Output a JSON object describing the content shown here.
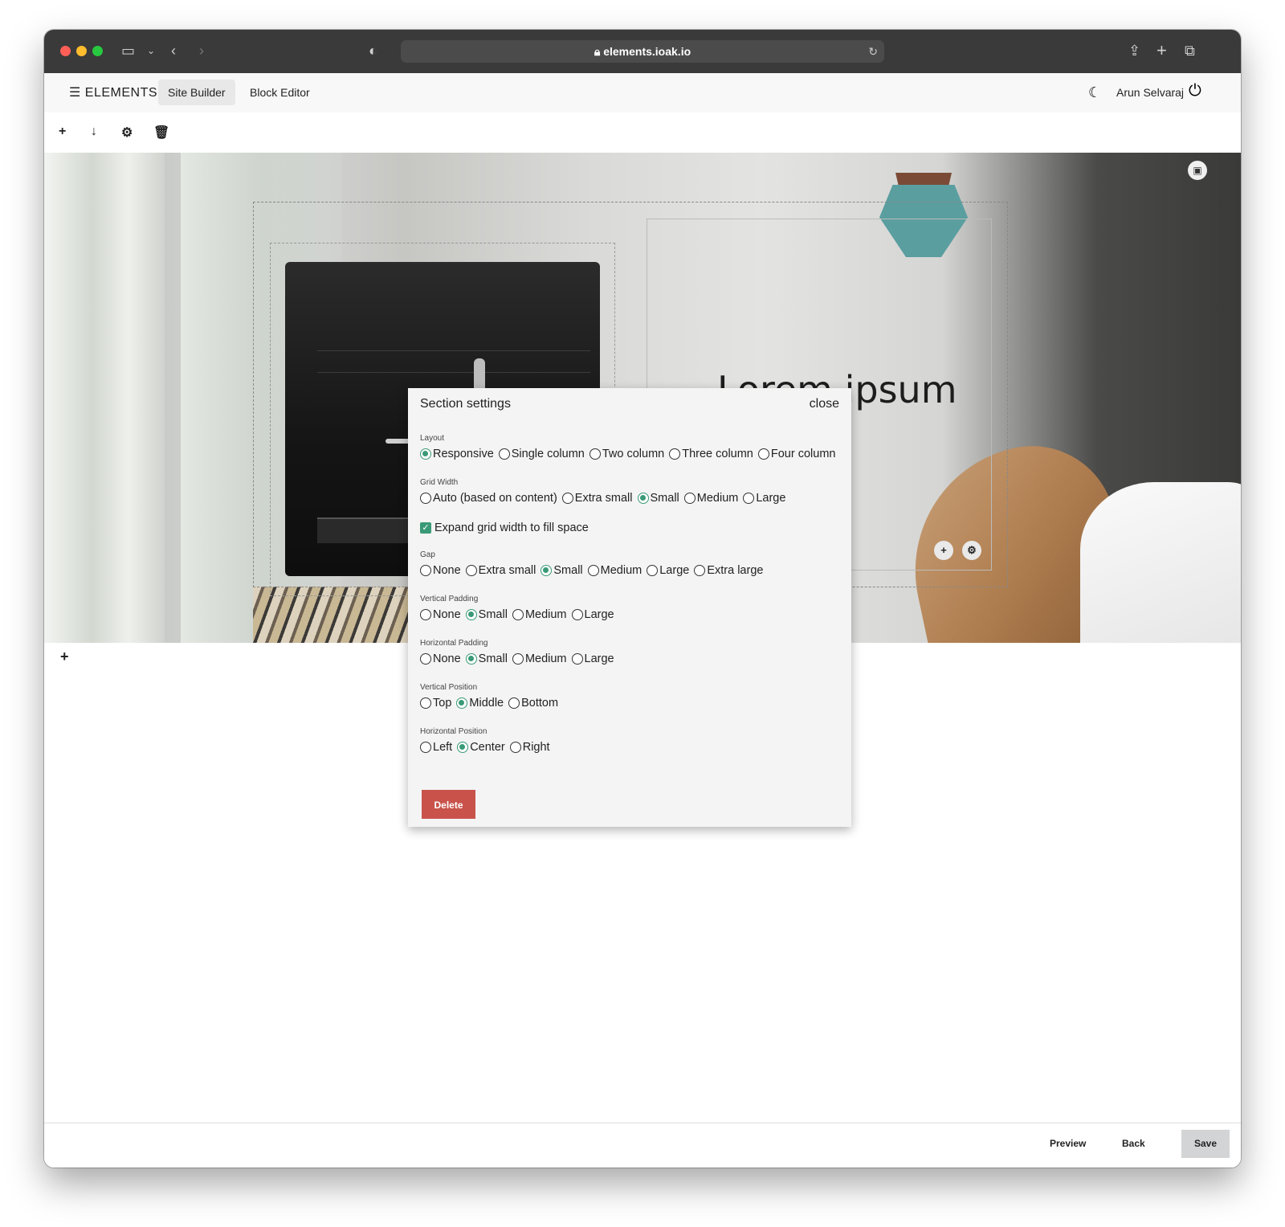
{
  "browser": {
    "url": "elements.ioak.io",
    "traffic_colors": [
      "#ff5f57",
      "#febc2e",
      "#28c840"
    ]
  },
  "app": {
    "brand": "ELEMENTS",
    "tabs": [
      {
        "label": "Site Builder",
        "active": true
      },
      {
        "label": "Block Editor",
        "active": false
      }
    ],
    "user_name": "Arun Selvaraj"
  },
  "hero": {
    "title": "Lorem ipsum"
  },
  "modal": {
    "title": "Section settings",
    "close_label": "close",
    "groups": [
      {
        "label": "Layout",
        "options": [
          "Responsive",
          "Single column",
          "Two column",
          "Three column",
          "Four column"
        ],
        "selected": "Responsive"
      },
      {
        "label": "Grid Width",
        "options": [
          "Auto (based on content)",
          "Extra small",
          "Small",
          "Medium",
          "Large"
        ],
        "selected": "Small"
      },
      {
        "label": "Gap",
        "options": [
          "None",
          "Extra small",
          "Small",
          "Medium",
          "Large",
          "Extra large"
        ],
        "selected": "Small"
      },
      {
        "label": "Vertical Padding",
        "options": [
          "None",
          "Small",
          "Medium",
          "Large"
        ],
        "selected": "Small"
      },
      {
        "label": "Horizontal Padding",
        "options": [
          "None",
          "Small",
          "Medium",
          "Large"
        ],
        "selected": "Small"
      },
      {
        "label": "Vertical Position",
        "options": [
          "Top",
          "Middle",
          "Bottom"
        ],
        "selected": "Middle"
      },
      {
        "label": "Horizontal Position",
        "options": [
          "Left",
          "Center",
          "Right"
        ],
        "selected": "Center"
      }
    ],
    "expand_checkbox": {
      "label": "Expand grid width to fill space",
      "checked": true
    },
    "delete_label": "Delete"
  },
  "footer": {
    "preview_label": "Preview",
    "back_label": "Back",
    "save_label": "Save"
  },
  "colors": {
    "accent": "#3a9a78",
    "danger": "#c9534b"
  }
}
